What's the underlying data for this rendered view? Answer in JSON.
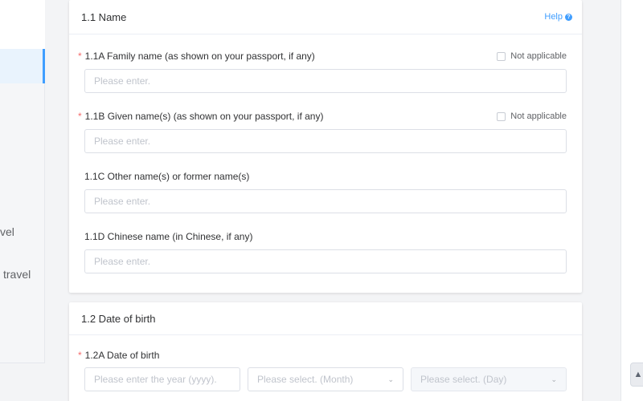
{
  "sidebar": {
    "items": [
      {
        "label": "vel"
      },
      {
        "label": "travel"
      }
    ]
  },
  "section_name": {
    "title": "1.1 Name",
    "help_label": "Help",
    "help_icon": "question-circle-icon",
    "fields": [
      {
        "required": true,
        "label": "1.1A Family name (as shown on your passport, if any)",
        "placeholder": "Please enter.",
        "value": "",
        "not_applicable_label": "Not applicable"
      },
      {
        "required": true,
        "label": "1.1B Given name(s) (as shown on your passport, if any)",
        "placeholder": "Please enter.",
        "value": "",
        "not_applicable_label": "Not applicable"
      },
      {
        "required": false,
        "label": "1.1C Other name(s) or former name(s)",
        "placeholder": "Please enter.",
        "value": ""
      },
      {
        "required": false,
        "label": "1.1D Chinese name (in Chinese, if any)",
        "placeholder": "Please enter.",
        "value": ""
      }
    ]
  },
  "section_dob": {
    "title": "1.2 Date of birth",
    "field_label": "1.2A Date of birth",
    "year_placeholder": "Please enter the year (yyyy).",
    "month_placeholder": "Please select. (Month)",
    "day_placeholder": "Please select. (Day)"
  },
  "colors": {
    "accent": "#409eff",
    "required": "#f56c6c",
    "background": "#f3f4f6"
  },
  "icons": {
    "scroll_top": "arrow-up-icon",
    "dropdown": "chevron-down-icon"
  }
}
